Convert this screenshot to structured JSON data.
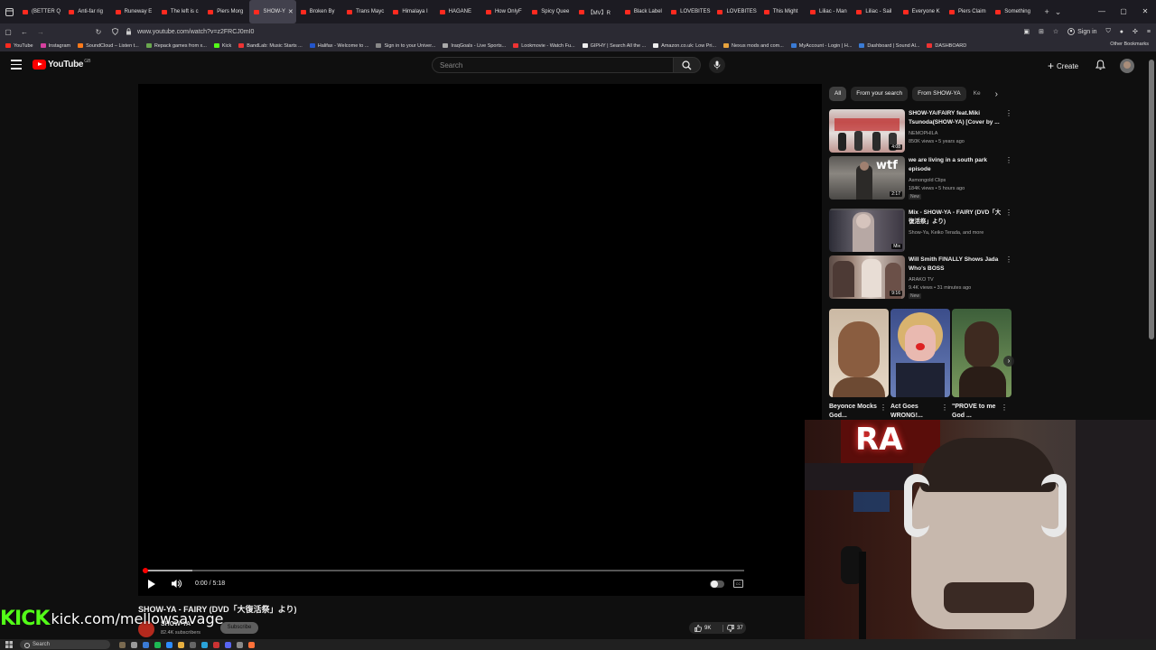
{
  "browser": {
    "tabs": [
      {
        "label": "(BETTER Q"
      },
      {
        "label": "Anti-far rig"
      },
      {
        "label": "Runeway E"
      },
      {
        "label": "The left is c"
      },
      {
        "label": "Piers Morg"
      },
      {
        "label": "SHOW-Y",
        "active": true
      },
      {
        "label": "Broken By"
      },
      {
        "label": "Trans Mayc"
      },
      {
        "label": "Himalaya I"
      },
      {
        "label": "HAGANE"
      },
      {
        "label": "How OnlyF"
      },
      {
        "label": "Spicy Quee"
      },
      {
        "label": "【MV】R"
      },
      {
        "label": "Black Label"
      },
      {
        "label": "LOVEBITES"
      },
      {
        "label": "LOVEBITES"
      },
      {
        "label": "This Might"
      },
      {
        "label": "Liliac - Man"
      },
      {
        "label": "Liliac - Sail"
      },
      {
        "label": "Everyone K"
      },
      {
        "label": "Piers Claim"
      },
      {
        "label": "Something"
      }
    ],
    "url": "www.youtube.com/watch?v=z2FRCJ0mI0",
    "sign_in": "Sign in",
    "bookmarks": [
      {
        "label": "YouTube",
        "color": "#ff2a1f"
      },
      {
        "label": "Instagram",
        "color": "#d6409f"
      },
      {
        "label": "SoundCloud – Listen t...",
        "color": "#ff7a1a"
      },
      {
        "label": "Repack games from x...",
        "color": "#6aa84f"
      },
      {
        "label": "Kick",
        "color": "#53fc18"
      },
      {
        "label": "BandLab: Music Starts ...",
        "color": "#e33"
      },
      {
        "label": "Halifax - Welcome to ...",
        "color": "#2255cc"
      },
      {
        "label": "Sign in to your Univer...",
        "color": "#888"
      },
      {
        "label": "IraqGoals - Live Sports...",
        "color": "#aaa"
      },
      {
        "label": "Lookmovie - Watch Fu...",
        "color": "#e33"
      },
      {
        "label": "GIPHY | Search All the ...",
        "color": "#eee"
      },
      {
        "label": "Amazon.co.uk: Low Pri...",
        "color": "#eee"
      },
      {
        "label": "Nexus mods and com...",
        "color": "#e8a33d"
      },
      {
        "label": "MyAccount - Login | H...",
        "color": "#3a7bd5"
      },
      {
        "label": "Dashboard | Sound Al...",
        "color": "#3a7bd5"
      },
      {
        "label": "DASHBOARD",
        "color": "#e33"
      }
    ],
    "other_bookmarks": "Other Bookmarks"
  },
  "youtube": {
    "logo": "YouTube",
    "region": "GB",
    "search_placeholder": "Search",
    "create": "Create"
  },
  "player": {
    "time": "0:00 / 5:18",
    "progress_fraction": 0.0
  },
  "video": {
    "title": "SHOW-YA - FAIRY (DVD「大復活祭」より)",
    "channel": "SHOW-YA",
    "subscribers": "82.4K subscribers",
    "subscribe": "Subscribe",
    "likes": "9K",
    "dislikes": "37"
  },
  "chips": [
    "All",
    "From your search",
    "From SHOW-YA",
    "Ke"
  ],
  "recommendations": [
    {
      "title": "SHOW-YA/FAIRY feat.Miki Tsunoda(SHOW-YA) [Cover by ...",
      "channel": "NEMOPHILA",
      "stats": "850K views • 5 years ago",
      "duration": "4:08",
      "new": ""
    },
    {
      "title": "we are living in a south park episode",
      "channel": "Asmongold Clips",
      "stats": "184K views • 5 hours ago",
      "duration": "2:17",
      "new": "New"
    },
    {
      "title": "Mix - SHOW-YA - FAIRY (DVD「大復活祭」より)",
      "channel": "Show-Ya, Keiko Terada, and more",
      "stats": "",
      "duration": "Mix",
      "new": ""
    },
    {
      "title": "Will Smith FINALLY Shows Jada Who's BOSS",
      "channel": "ARAKO TV",
      "stats": "9.4K views • 31 minutes ago",
      "duration": "9:16",
      "new": "New"
    }
  ],
  "shorts": [
    {
      "title": "Beyonce Mocks God..."
    },
    {
      "title": "Act Goes WRONG!..."
    },
    {
      "title": "\"PROVE to me God ..."
    }
  ],
  "overlay": {
    "kick_logo": "KICK",
    "kick_url": "kick.com/mellowsavage",
    "webcam_sign": "RA"
  },
  "taskbar": {
    "search": "Search"
  }
}
